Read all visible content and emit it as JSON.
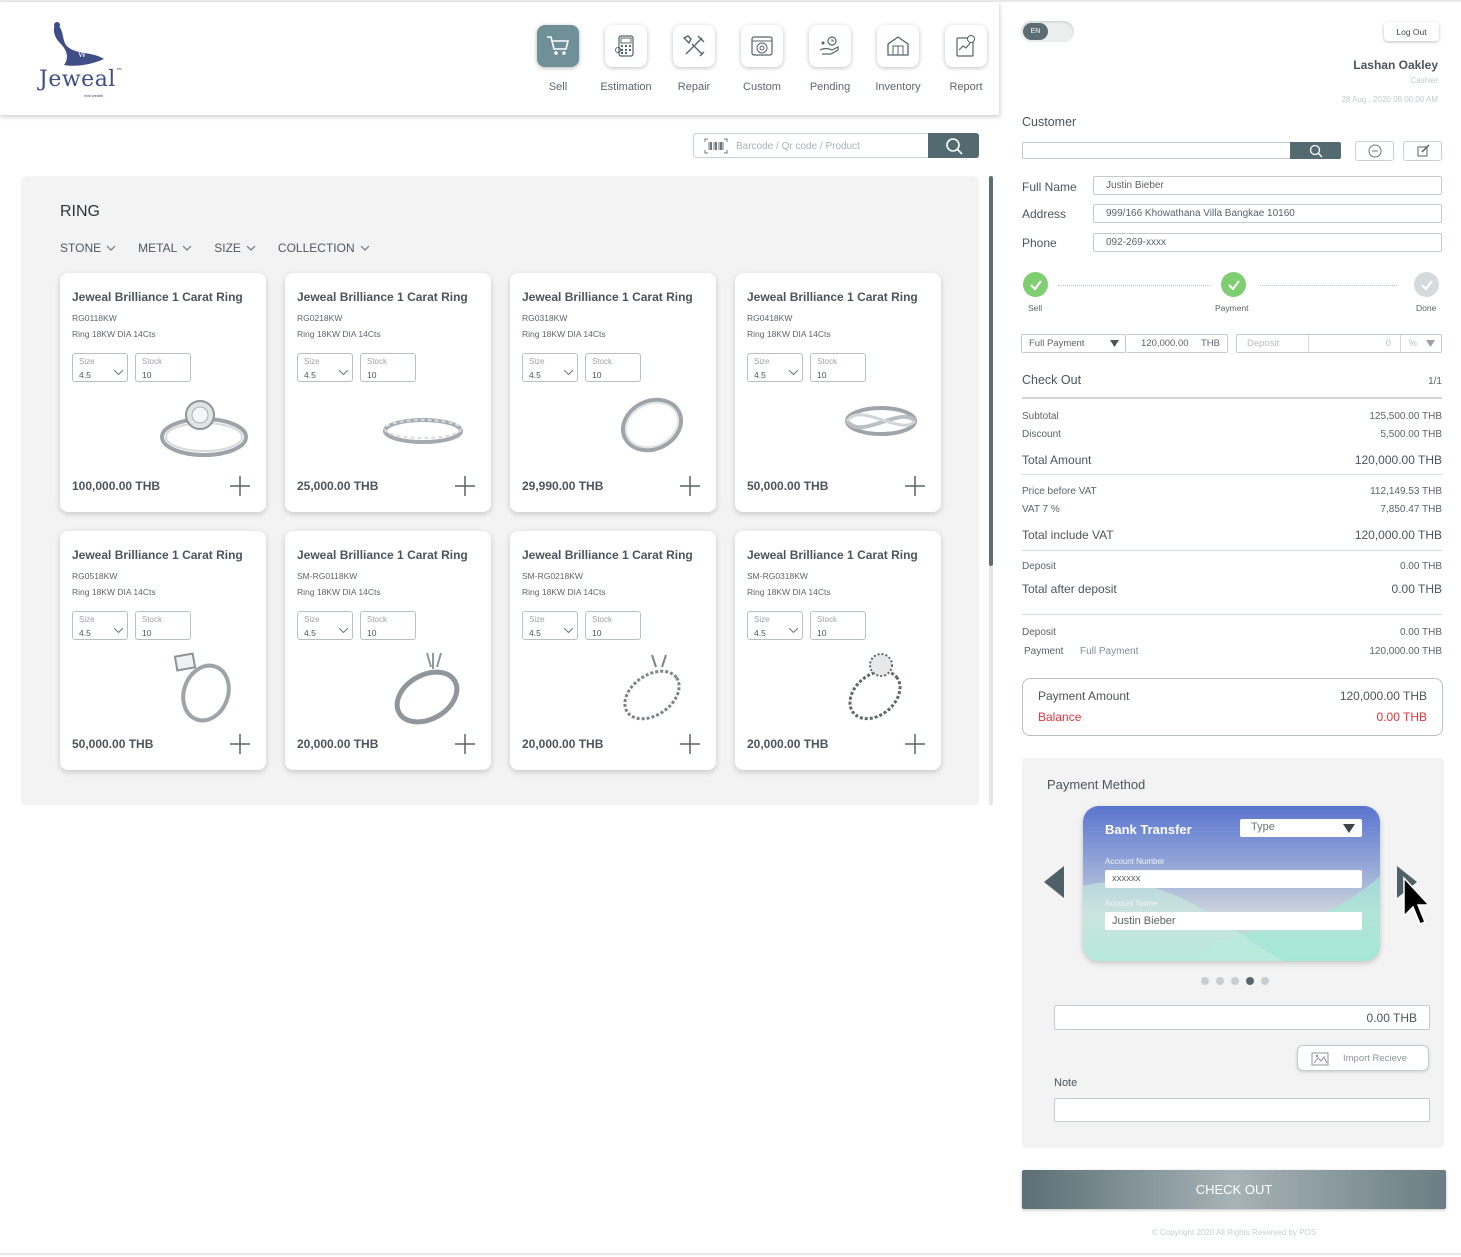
{
  "brand": {
    "name": "Jeweal",
    "trademark": "™",
    "tagline": "real wealth"
  },
  "nav": [
    {
      "label": "Sell",
      "icon": "cart-icon",
      "active": true
    },
    {
      "label": "Estimation",
      "icon": "calculator-icon",
      "active": false
    },
    {
      "label": "Repair",
      "icon": "tools-icon",
      "active": false
    },
    {
      "label": "Custom",
      "icon": "custom-icon",
      "active": false
    },
    {
      "label": "Pending",
      "icon": "pending-icon",
      "active": false
    },
    {
      "label": "Inventory",
      "icon": "inventory-icon",
      "active": false
    },
    {
      "label": "Report",
      "icon": "report-icon",
      "active": false
    }
  ],
  "search": {
    "placeholder": "Barcode / Qr code / Product"
  },
  "catalog": {
    "title": "RING",
    "filters": [
      "STONE",
      "METAL",
      "SIZE",
      "COLLECTION"
    ],
    "size_label": "Size",
    "stock_label": "Stock",
    "products": [
      {
        "name": "Jeweal Brilliance 1 Carat Ring",
        "code": "RG0118KW",
        "desc": "Ring 18KW DIA 14Cts",
        "size": "4.5",
        "stock": "10",
        "price": "100,000.00 THB",
        "image": "halo-ring-icon"
      },
      {
        "name": "Jeweal Brilliance 1 Carat Ring",
        "code": "RG0218KW",
        "desc": "Ring 18KW DIA 14Cts",
        "size": "4.5",
        "stock": "10",
        "price": "25,000.00 THB",
        "image": "eternity-band-icon"
      },
      {
        "name": "Jeweal Brilliance 1 Carat Ring",
        "code": "RG0318KW",
        "desc": "Ring 18KW DIA 14Cts",
        "size": "4.5",
        "stock": "10",
        "price": "29,990.00 THB",
        "image": "twist-band-icon"
      },
      {
        "name": "Jeweal Brilliance 1 Carat Ring",
        "code": "RG0418KW",
        "desc": "Ring 18KW DIA 14Cts",
        "size": "4.5",
        "stock": "10",
        "price": "50,000.00 THB",
        "image": "crossover-ring-icon"
      },
      {
        "name": "Jeweal Brilliance 1 Carat Ring",
        "code": "RG0518KW",
        "desc": "Ring 18KW DIA 14Cts",
        "size": "4.5",
        "stock": "10",
        "price": "50,000.00 THB",
        "image": "solitaire-ring-icon"
      },
      {
        "name": "Jeweal Brilliance 1 Carat Ring",
        "code": "SM-RG0118KW",
        "desc": "Ring 18KW DIA 14Cts",
        "size": "4.5",
        "stock": "10",
        "price": "20,000.00 THB",
        "image": "setting-ring-icon"
      },
      {
        "name": "Jeweal Brilliance 1 Carat Ring",
        "code": "SM-RG0218KW",
        "desc": "Ring 18KW DIA 14Cts",
        "size": "4.5",
        "stock": "10",
        "price": "20,000.00 THB",
        "image": "pave-setting-ring-icon"
      },
      {
        "name": "Jeweal Brilliance 1 Carat Ring",
        "code": "SM-RG0318KW",
        "desc": "Ring 18KW DIA 14Cts",
        "size": "4.5",
        "stock": "10",
        "price": "20,000.00 THB",
        "image": "halo-setting-ring-icon"
      }
    ]
  },
  "session": {
    "lang": "EN",
    "logout": "Log Out",
    "user": "Lashan Oakley",
    "role": "Cashier",
    "datetime": "28 Aug , 2020  08:00:00 AM"
  },
  "customer": {
    "title": "Customer",
    "search_value": "",
    "fields": [
      {
        "label": "Full Name",
        "value": "Justin Bieber"
      },
      {
        "label": "Address",
        "value": "999/166 Khowathana Villa Bangkae 10160"
      },
      {
        "label": "Phone",
        "value": "092-269-xxxx"
      }
    ]
  },
  "steps": [
    {
      "label": "Sell",
      "done": true
    },
    {
      "label": "Payment",
      "done": true
    },
    {
      "label": "Done",
      "done": false
    }
  ],
  "payment_row": {
    "type": "Full Payment",
    "amount": "120,000.00",
    "currency": "THB",
    "deposit_placeholder": "Deposit",
    "deposit_value": "0",
    "unit": "%"
  },
  "checkout": {
    "title": "Check Out",
    "page": "1/1",
    "subtotal_label": "Subtotal",
    "subtotal": "125,500.00  THB",
    "discount_label": "Discount",
    "discount": "5,500.00  THB",
    "total_label": "Total Amount",
    "total": "120,000.00  THB",
    "pre_vat_label": "Price before VAT",
    "pre_vat": "112,149.53 THB",
    "vat_label": "VAT 7 %",
    "vat": "7,850.47 THB",
    "incl_vat_label": "Total include VAT",
    "incl_vat": "120,000.00  THB",
    "deposit_label": "Deposit",
    "deposit": "0.00 THB",
    "after_deposit_label": "Total after deposit",
    "after_deposit": "0.00 THB",
    "deposit2_label": "Deposit",
    "deposit2": "0.00 THB",
    "payment_label": "Payment",
    "payment_type": "Full Payment",
    "payment": "120,000.00  THB",
    "payment_amount_label": "Payment Amount",
    "payment_amount": "120,000.00  THB",
    "balance_label": "Balance",
    "balance": "0.00  THB",
    "balance_color": "#e8323c"
  },
  "payment_method": {
    "title": "Payment Method",
    "card_title": "Bank Transfer",
    "type_placeholder": "Type",
    "account_number_label": "Account Number",
    "account_number": "xxxxxx",
    "account_name_label": "Account Name",
    "account_name": "Justin Bieber",
    "slide_count": 5,
    "active_slide": 4,
    "amount": "0.00  THB",
    "import_label": "Import Recieve",
    "note_label": "Note",
    "note_value": ""
  },
  "checkout_button": "CHECK OUT",
  "copyright": "© Copyright 2020 All Rights Reserved by POS",
  "colors": {
    "accent": "#526a70",
    "nav_active": "#6f9097",
    "success": "#7fce72",
    "brand": "#3f4e87"
  }
}
